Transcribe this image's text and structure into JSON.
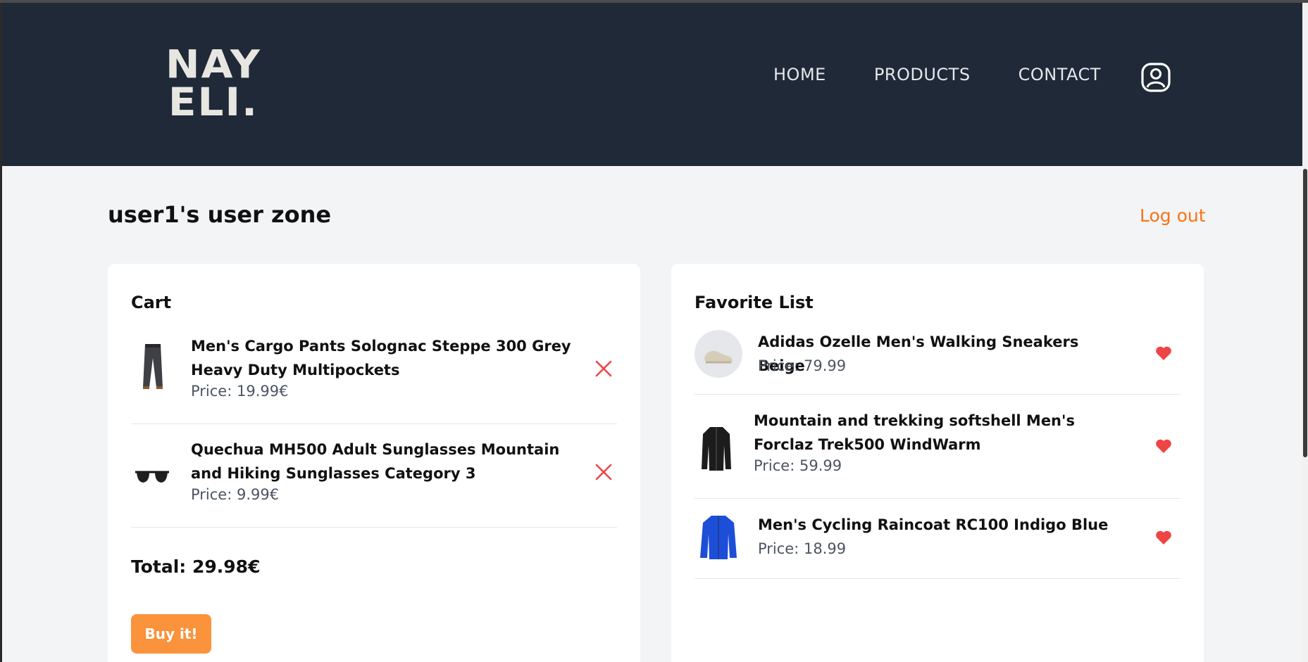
{
  "header": {
    "logo_line1": "NAY",
    "logo_line2": "ELI.",
    "nav": [
      "HOME",
      "PRODUCTS",
      "CONTACT"
    ]
  },
  "zone": {
    "title": "user1's user zone",
    "logout": "Log out"
  },
  "cart": {
    "title": "Cart",
    "items": [
      {
        "name": "Men's Cargo Pants Solognac Steppe 300 Grey Heavy Duty Multipockets",
        "price": "Price: 19.99€",
        "thumb_icon": "cargo-pants-image"
      },
      {
        "name": "Quechua MH500 Adult Sunglasses Mountain and Hiking Sunglasses Category 3",
        "price": "Price: 9.99€",
        "thumb_icon": "sunglasses-image"
      }
    ],
    "total": "Total: 29.98€",
    "buy_label": "Buy it!"
  },
  "favorites": {
    "title": "Favorite List",
    "items": [
      {
        "name": "Adidas Ozelle Men's Walking Sneakers Beige",
        "price": "Price: 79.99",
        "thumb_icon": "sneakers-image"
      },
      {
        "name": "Mountain and trekking softshell Men's Forclaz Trek500 WindWarm",
        "price": "Price: 59.99",
        "thumb_icon": "softshell-jacket-image"
      },
      {
        "name": "Men's Cycling Raincoat RC100 Indigo Blue",
        "price": "Price: 18.99",
        "thumb_icon": "raincoat-image"
      }
    ]
  },
  "colors": {
    "header_bg": "#1f2937",
    "accent": "#f97316",
    "button": "#fb923c",
    "remove": "#ef4444",
    "heart": "#ef4444"
  }
}
